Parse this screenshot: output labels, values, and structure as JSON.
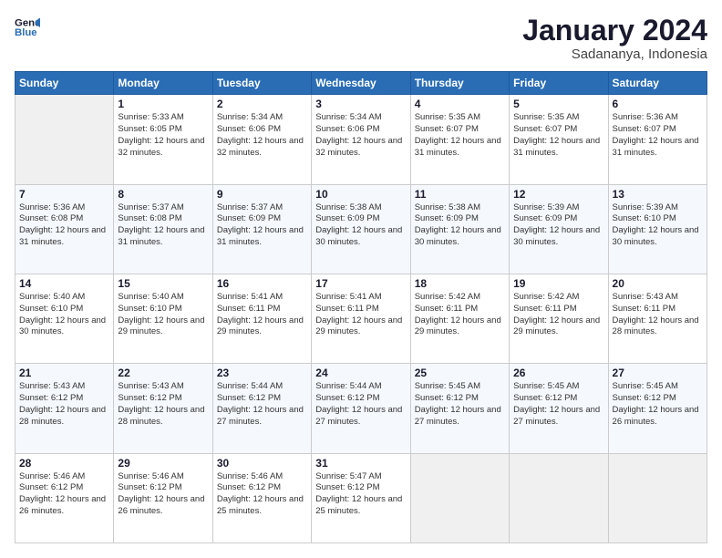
{
  "logo": {
    "line1": "General",
    "line2": "Blue"
  },
  "title": "January 2024",
  "subtitle": "Sadananya, Indonesia",
  "header_days": [
    "Sunday",
    "Monday",
    "Tuesday",
    "Wednesday",
    "Thursday",
    "Friday",
    "Saturday"
  ],
  "weeks": [
    [
      {
        "day": "",
        "sunrise": "",
        "sunset": "",
        "daylight": ""
      },
      {
        "day": "1",
        "sunrise": "Sunrise: 5:33 AM",
        "sunset": "Sunset: 6:05 PM",
        "daylight": "Daylight: 12 hours and 32 minutes."
      },
      {
        "day": "2",
        "sunrise": "Sunrise: 5:34 AM",
        "sunset": "Sunset: 6:06 PM",
        "daylight": "Daylight: 12 hours and 32 minutes."
      },
      {
        "day": "3",
        "sunrise": "Sunrise: 5:34 AM",
        "sunset": "Sunset: 6:06 PM",
        "daylight": "Daylight: 12 hours and 32 minutes."
      },
      {
        "day": "4",
        "sunrise": "Sunrise: 5:35 AM",
        "sunset": "Sunset: 6:07 PM",
        "daylight": "Daylight: 12 hours and 31 minutes."
      },
      {
        "day": "5",
        "sunrise": "Sunrise: 5:35 AM",
        "sunset": "Sunset: 6:07 PM",
        "daylight": "Daylight: 12 hours and 31 minutes."
      },
      {
        "day": "6",
        "sunrise": "Sunrise: 5:36 AM",
        "sunset": "Sunset: 6:07 PM",
        "daylight": "Daylight: 12 hours and 31 minutes."
      }
    ],
    [
      {
        "day": "7",
        "sunrise": "Sunrise: 5:36 AM",
        "sunset": "Sunset: 6:08 PM",
        "daylight": "Daylight: 12 hours and 31 minutes."
      },
      {
        "day": "8",
        "sunrise": "Sunrise: 5:37 AM",
        "sunset": "Sunset: 6:08 PM",
        "daylight": "Daylight: 12 hours and 31 minutes."
      },
      {
        "day": "9",
        "sunrise": "Sunrise: 5:37 AM",
        "sunset": "Sunset: 6:09 PM",
        "daylight": "Daylight: 12 hours and 31 minutes."
      },
      {
        "day": "10",
        "sunrise": "Sunrise: 5:38 AM",
        "sunset": "Sunset: 6:09 PM",
        "daylight": "Daylight: 12 hours and 30 minutes."
      },
      {
        "day": "11",
        "sunrise": "Sunrise: 5:38 AM",
        "sunset": "Sunset: 6:09 PM",
        "daylight": "Daylight: 12 hours and 30 minutes."
      },
      {
        "day": "12",
        "sunrise": "Sunrise: 5:39 AM",
        "sunset": "Sunset: 6:09 PM",
        "daylight": "Daylight: 12 hours and 30 minutes."
      },
      {
        "day": "13",
        "sunrise": "Sunrise: 5:39 AM",
        "sunset": "Sunset: 6:10 PM",
        "daylight": "Daylight: 12 hours and 30 minutes."
      }
    ],
    [
      {
        "day": "14",
        "sunrise": "Sunrise: 5:40 AM",
        "sunset": "Sunset: 6:10 PM",
        "daylight": "Daylight: 12 hours and 30 minutes."
      },
      {
        "day": "15",
        "sunrise": "Sunrise: 5:40 AM",
        "sunset": "Sunset: 6:10 PM",
        "daylight": "Daylight: 12 hours and 29 minutes."
      },
      {
        "day": "16",
        "sunrise": "Sunrise: 5:41 AM",
        "sunset": "Sunset: 6:11 PM",
        "daylight": "Daylight: 12 hours and 29 minutes."
      },
      {
        "day": "17",
        "sunrise": "Sunrise: 5:41 AM",
        "sunset": "Sunset: 6:11 PM",
        "daylight": "Daylight: 12 hours and 29 minutes."
      },
      {
        "day": "18",
        "sunrise": "Sunrise: 5:42 AM",
        "sunset": "Sunset: 6:11 PM",
        "daylight": "Daylight: 12 hours and 29 minutes."
      },
      {
        "day": "19",
        "sunrise": "Sunrise: 5:42 AM",
        "sunset": "Sunset: 6:11 PM",
        "daylight": "Daylight: 12 hours and 29 minutes."
      },
      {
        "day": "20",
        "sunrise": "Sunrise: 5:43 AM",
        "sunset": "Sunset: 6:11 PM",
        "daylight": "Daylight: 12 hours and 28 minutes."
      }
    ],
    [
      {
        "day": "21",
        "sunrise": "Sunrise: 5:43 AM",
        "sunset": "Sunset: 6:12 PM",
        "daylight": "Daylight: 12 hours and 28 minutes."
      },
      {
        "day": "22",
        "sunrise": "Sunrise: 5:43 AM",
        "sunset": "Sunset: 6:12 PM",
        "daylight": "Daylight: 12 hours and 28 minutes."
      },
      {
        "day": "23",
        "sunrise": "Sunrise: 5:44 AM",
        "sunset": "Sunset: 6:12 PM",
        "daylight": "Daylight: 12 hours and 27 minutes."
      },
      {
        "day": "24",
        "sunrise": "Sunrise: 5:44 AM",
        "sunset": "Sunset: 6:12 PM",
        "daylight": "Daylight: 12 hours and 27 minutes."
      },
      {
        "day": "25",
        "sunrise": "Sunrise: 5:45 AM",
        "sunset": "Sunset: 6:12 PM",
        "daylight": "Daylight: 12 hours and 27 minutes."
      },
      {
        "day": "26",
        "sunrise": "Sunrise: 5:45 AM",
        "sunset": "Sunset: 6:12 PM",
        "daylight": "Daylight: 12 hours and 27 minutes."
      },
      {
        "day": "27",
        "sunrise": "Sunrise: 5:45 AM",
        "sunset": "Sunset: 6:12 PM",
        "daylight": "Daylight: 12 hours and 26 minutes."
      }
    ],
    [
      {
        "day": "28",
        "sunrise": "Sunrise: 5:46 AM",
        "sunset": "Sunset: 6:12 PM",
        "daylight": "Daylight: 12 hours and 26 minutes."
      },
      {
        "day": "29",
        "sunrise": "Sunrise: 5:46 AM",
        "sunset": "Sunset: 6:12 PM",
        "daylight": "Daylight: 12 hours and 26 minutes."
      },
      {
        "day": "30",
        "sunrise": "Sunrise: 5:46 AM",
        "sunset": "Sunset: 6:12 PM",
        "daylight": "Daylight: 12 hours and 25 minutes."
      },
      {
        "day": "31",
        "sunrise": "Sunrise: 5:47 AM",
        "sunset": "Sunset: 6:12 PM",
        "daylight": "Daylight: 12 hours and 25 minutes."
      },
      {
        "day": "",
        "sunrise": "",
        "sunset": "",
        "daylight": ""
      },
      {
        "day": "",
        "sunrise": "",
        "sunset": "",
        "daylight": ""
      },
      {
        "day": "",
        "sunrise": "",
        "sunset": "",
        "daylight": ""
      }
    ]
  ]
}
